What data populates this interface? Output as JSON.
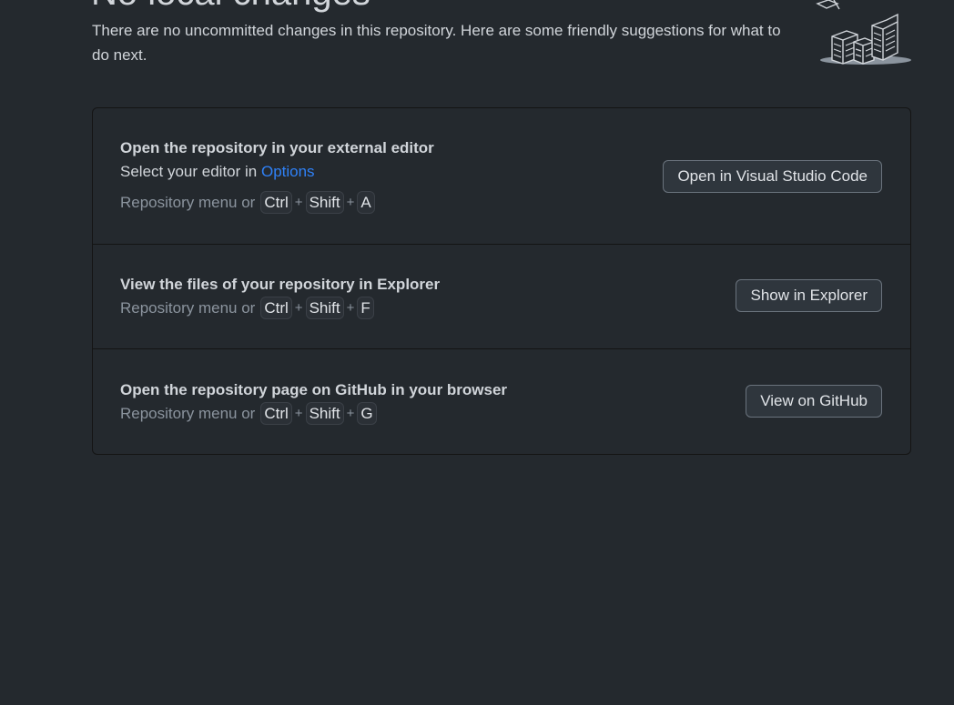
{
  "header": {
    "title": "No local changes",
    "subtitle": "There are no uncommitted changes in this repository. Here are some friendly suggestions for what to do next.",
    "illustration": "paper-stack-icon"
  },
  "suggestions": [
    {
      "title": "Open the repository in your external editor",
      "description_prefix": "Select your editor in ",
      "description_link": "Options",
      "shortcut_prefix": "Repository menu or",
      "keys": [
        "Ctrl",
        "Shift",
        "A"
      ],
      "button_label": "Open in Visual Studio Code"
    },
    {
      "title": "View the files of your repository in Explorer",
      "shortcut_prefix": "Repository menu or",
      "keys": [
        "Ctrl",
        "Shift",
        "F"
      ],
      "button_label": "Show in Explorer"
    },
    {
      "title": "Open the repository page on GitHub in your browser",
      "shortcut_prefix": "Repository menu or",
      "keys": [
        "Ctrl",
        "Shift",
        "G"
      ],
      "button_label": "View on GitHub"
    }
  ],
  "plus_sign": "+",
  "colors": {
    "background": "#24292e",
    "link": "#2f81f7",
    "muted_text": "#8b949e",
    "button_bg": "#2f363d"
  }
}
